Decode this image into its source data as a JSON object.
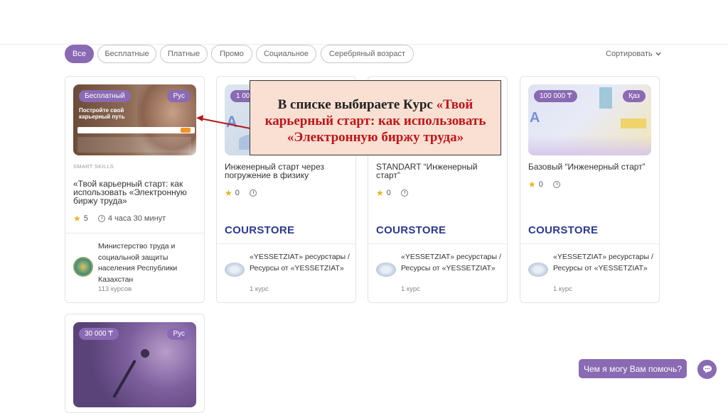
{
  "filters": {
    "all": "Все",
    "free": "Бесплатные",
    "paid": "Платные",
    "promo": "Промо",
    "social": "Социальное",
    "silver_age": "Серебряный возраст"
  },
  "sort_label": "Сортировать",
  "callout": {
    "black_text": "В списке выбираете Курс",
    "red_text": "«Твой карьерный старт: как использовать «Электронную биржу труда»"
  },
  "cards": [
    {
      "price_badge": "Бесплатный",
      "lang_badge": "Рус",
      "provider_tag": "SMART SKILLS",
      "title": "«Твой карьерный старт: как использовать «Электронную биржу труда»",
      "rating": "5",
      "duration": "4 часа 30 минут",
      "owner_name": "Министерство труда и социальной защиты населения Республики Казахстан",
      "owner_count": "113 курсов",
      "thumb_banner": "Постройте свой карьерный путь"
    },
    {
      "price_badge": "1 000",
      "title": "Инженерный старт через погружение в физику",
      "rating": "0",
      "brand": "COURSTORE",
      "owner_name": "«YESSETZIAT» ресурстары / Ресурсы от «YESSETZIAT»",
      "owner_count": "1 курс"
    },
    {
      "title": "STANDART “Инженерный старт”",
      "rating": "0",
      "brand": "COURSTORE",
      "owner_name": "«YESSETZIAT» ресурстары / Ресурсы от «YESSETZIAT»",
      "owner_count": "1 курс"
    },
    {
      "price_badge": "100 000 ₸",
      "lang_badge": "Қаз",
      "title": "Базовый “Инженерный старт”",
      "rating": "0",
      "brand": "COURSTORE",
      "owner_name": "«YESSETZIAT» ресурстары / Ресурсы от «YESSETZIAT»",
      "owner_count": "1 курс"
    },
    {
      "price_badge": "30 000 ₸",
      "lang_badge": "Рус"
    }
  ],
  "chat": {
    "prompt": "Чем я могу Вам помочь?"
  },
  "colors": {
    "accent": "#8a6ab3",
    "brand_blue": "#2b3a8f",
    "callout_bg": "#f9e0d2",
    "callout_red": "#c0141b",
    "star": "#e9b320"
  },
  "icons": [
    "star-icon",
    "clock-icon",
    "chevron-down-icon",
    "chat-icon",
    "arrow-icon"
  ]
}
